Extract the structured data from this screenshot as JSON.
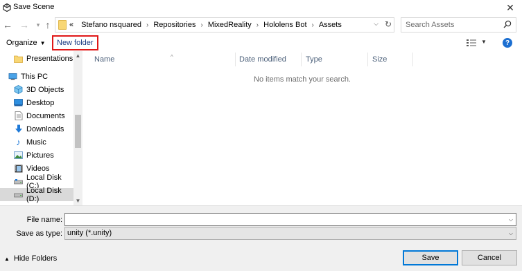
{
  "window": {
    "title": "Save Scene",
    "close_icon": "close-icon"
  },
  "address": {
    "overflow": "«",
    "crumbs": [
      "Stefano nsquared",
      "Repositories",
      "MixedReality",
      "Hololens Bot",
      "Assets"
    ]
  },
  "search": {
    "placeholder": "Search Assets"
  },
  "toolbar": {
    "organize_label": "Organize",
    "new_folder_label": "New folder",
    "help_label": "?"
  },
  "nav": {
    "items": [
      {
        "label": "Presentations",
        "icon": "folder-icon"
      },
      {
        "label": "This PC",
        "icon": "computer-icon"
      },
      {
        "label": "3D Objects",
        "icon": "3d-objects-icon"
      },
      {
        "label": "Desktop",
        "icon": "desktop-icon"
      },
      {
        "label": "Documents",
        "icon": "documents-icon"
      },
      {
        "label": "Downloads",
        "icon": "downloads-icon"
      },
      {
        "label": "Music",
        "icon": "music-icon"
      },
      {
        "label": "Pictures",
        "icon": "pictures-icon"
      },
      {
        "label": "Videos",
        "icon": "videos-icon"
      },
      {
        "label": "Local Disk (C:)",
        "icon": "drive-icon"
      },
      {
        "label": "Local Disk (D:)",
        "icon": "drive-icon",
        "selected": true
      }
    ]
  },
  "filelist": {
    "columns": [
      "Name",
      "Date modified",
      "Type",
      "Size"
    ],
    "empty_message": "No items match your search."
  },
  "form": {
    "file_name_label": "File name:",
    "file_name_value": "",
    "save_as_type_label": "Save as type:",
    "save_as_type_value": "unity (*.unity)"
  },
  "footer": {
    "hide_folders_label": "Hide Folders",
    "save_label": "Save",
    "cancel_label": "Cancel"
  },
  "colors": {
    "highlight_border": "#e01717",
    "link_text": "#1a3c84",
    "selected_row": "#d9d9d9",
    "primary_button_border": "#0078d7"
  }
}
